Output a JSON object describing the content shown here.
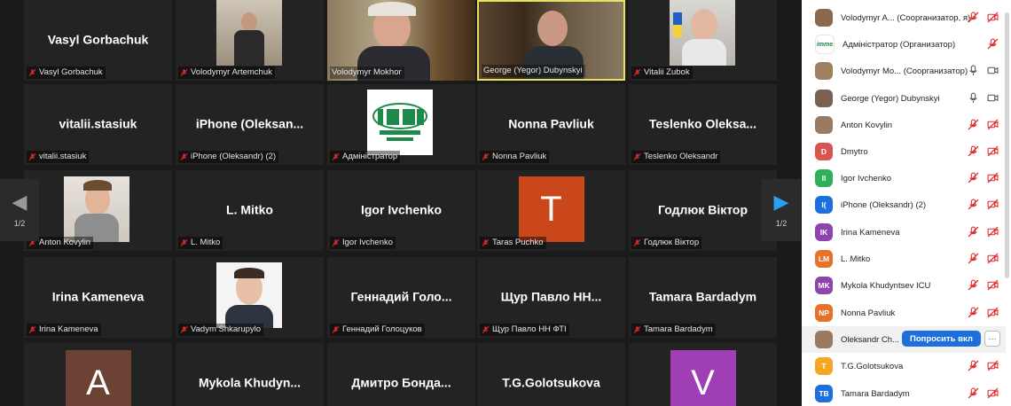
{
  "gallery": {
    "page_indicator": "1/2",
    "tiles": [
      {
        "name": "Vasyl Gorbachuk",
        "caption": "Vasyl Gorbachuk"
      },
      {
        "name": "",
        "caption": "Volodymyr Artemchuk"
      },
      {
        "name": "",
        "caption": "Volodymyr Mokhor"
      },
      {
        "name": "",
        "caption": "George (Yegor) Dubynskyi"
      },
      {
        "name": "",
        "caption": "Vitalii Zubok"
      },
      {
        "name": "vitalii.stasiuk",
        "caption": "vitalii.stasiuk"
      },
      {
        "name": "iPhone (Oleksan...",
        "caption": "iPhone (Oleksandr) (2)"
      },
      {
        "name": "",
        "caption": "Адміністратор"
      },
      {
        "name": "Nonna Pavliuk",
        "caption": "Nonna Pavliuk"
      },
      {
        "name": "Teslenko Oleksa...",
        "caption": "Teslenko Oleksandr"
      },
      {
        "name": "",
        "caption": "Anton Kovylin"
      },
      {
        "name": "L. Mitko",
        "caption": "L. Mitko"
      },
      {
        "name": "Igor Ivchenko",
        "caption": "Igor Ivchenko"
      },
      {
        "name": "T",
        "caption": "Taras Puchko"
      },
      {
        "name": "Годлюк Віктор",
        "caption": "Годлюк Віктор"
      },
      {
        "name": "Irina Kameneva",
        "caption": "Irina Kameneva"
      },
      {
        "name": "",
        "caption": "Vadym Shkarupylo"
      },
      {
        "name": "Геннадий Голо...",
        "caption": "Геннадий Голоцуков"
      },
      {
        "name": "Щур Павло НН...",
        "caption": "Щур Павло НН ФТІ"
      },
      {
        "name": "Tamara Bardadym",
        "caption": "Tamara Bardadym"
      },
      {
        "name": "A",
        "caption": ""
      },
      {
        "name": "Mykola Khudyn...",
        "caption": ""
      },
      {
        "name": "Дмитро Бонда...",
        "caption": ""
      },
      {
        "name": "T.G.Golotsukova",
        "caption": ""
      },
      {
        "name": "V",
        "caption": ""
      }
    ]
  },
  "participants": [
    {
      "name": "Volodymyr A... (Соорганизатор, я)",
      "initials": "",
      "color": "#8a6a4a"
    },
    {
      "name": "Адміністратор (Организатор)",
      "initials": "",
      "color": "#ffffff"
    },
    {
      "name": "Volodymyr Mo... (Соорганизатор)",
      "initials": "",
      "color": "#a08060"
    },
    {
      "name": "George (Yegor) Dubynskyi",
      "initials": "",
      "color": "#7a6050"
    },
    {
      "name": "Anton Kovylin",
      "initials": "",
      "color": "#9a7a60"
    },
    {
      "name": "Dmytro",
      "initials": "D",
      "color": "#d9534f"
    },
    {
      "name": "Igor Ivchenko",
      "initials": "II",
      "color": "#2eaf5a"
    },
    {
      "name": "iPhone (Oleksandr) (2)",
      "initials": "I(",
      "color": "#1c6fdc"
    },
    {
      "name": "Irina Kameneva",
      "initials": "IK",
      "color": "#8e44ad"
    },
    {
      "name": "L. Mitko",
      "initials": "LM",
      "color": "#e8712a"
    },
    {
      "name": "Mykola Khudyntsev ICU",
      "initials": "MK",
      "color": "#8e44ad"
    },
    {
      "name": "Nonna Pavliuk",
      "initials": "NP",
      "color": "#e8712a"
    },
    {
      "name": "Oleksandr Ch...",
      "initials": "",
      "color": "#9a7a60"
    },
    {
      "name": "T.G.Golotsukova",
      "initials": "T",
      "color": "#f5a623"
    },
    {
      "name": "Tamara Bardadym",
      "initials": "TB",
      "color": "#1c6fdc"
    }
  ],
  "hover_row": {
    "ask_label": "Попросить вкл",
    "more_label": "···"
  },
  "colors": {
    "active_speaker": "#e8e063",
    "muted_red": "#e02828",
    "tile_bg": "#232323",
    "taras_avatar": "#c9471b",
    "a_avatar": "#6b4233",
    "v_avatar": "#a03fb5"
  }
}
